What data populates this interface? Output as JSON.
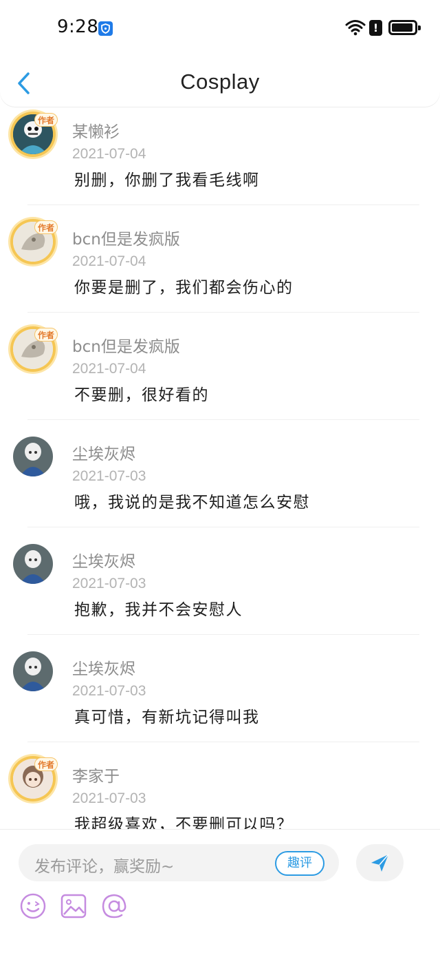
{
  "status_bar": {
    "time": "9:28",
    "alert_icon": "!"
  },
  "header": {
    "title": "Cosplay",
    "back_icon": "chevron-left-icon"
  },
  "comments": [
    {
      "name": "某懒衫",
      "date": "2021-07-04",
      "text": "别删，你删了我看毛线啊",
      "author": true,
      "badge": "作者"
    },
    {
      "name": "bcn但是发疯版",
      "date": "2021-07-04",
      "text": "你要是删了，我们都会伤心的",
      "author": true,
      "badge": "作者"
    },
    {
      "name": "bcn但是发疯版",
      "date": "2021-07-04",
      "text": "不要删，很好看的",
      "author": true,
      "badge": "作者"
    },
    {
      "name": "尘埃灰烬",
      "date": "2021-07-03",
      "text": "哦，我说的是我不知道怎么安慰",
      "author": false
    },
    {
      "name": "尘埃灰烬",
      "date": "2021-07-03",
      "text": "抱歉，我并不会安慰人",
      "author": false
    },
    {
      "name": "尘埃灰烬",
      "date": "2021-07-03",
      "text": "真可惜，有新坑记得叫我",
      "author": false
    },
    {
      "name": "李家于",
      "date": "2021-07-03",
      "text": "我超级喜欢，不要删可以吗？",
      "author": true,
      "badge": "作者"
    }
  ],
  "compose": {
    "placeholder": "发布评论，赢奖励~",
    "quping_label": "趣评",
    "send_icon": "send-icon",
    "tools": [
      "emoji-icon",
      "image-icon",
      "mention-icon"
    ]
  },
  "colors": {
    "accent": "#2c9be3",
    "tool_purple": "#c58be0",
    "author_ring": "#f5c654"
  }
}
